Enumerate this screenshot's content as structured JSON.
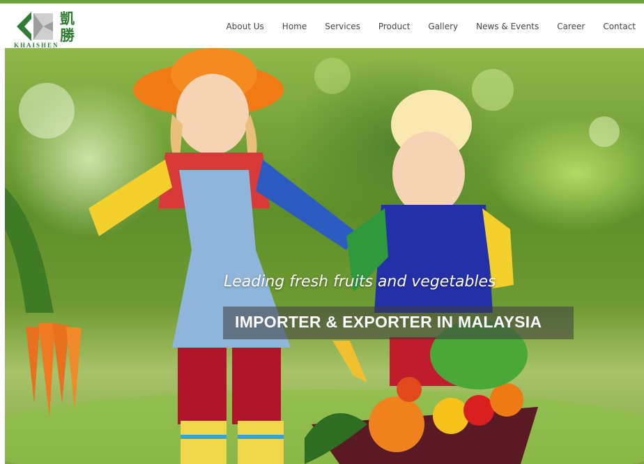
{
  "logo": {
    "chinese": "凱勝",
    "english": "KHAISHEN",
    "icon": "khaishen-logo-icon"
  },
  "nav": {
    "items": [
      {
        "label": "About Us"
      },
      {
        "label": "Home"
      },
      {
        "label": "Services"
      },
      {
        "label": "Product"
      },
      {
        "label": "Gallery"
      },
      {
        "label": "News & Events"
      },
      {
        "label": "Career"
      },
      {
        "label": "Contact"
      }
    ]
  },
  "hero": {
    "tagline": "Leading fresh fruits and vegetables",
    "banner": "IMPORTER & EXPORTER IN MALAYSIA"
  },
  "colors": {
    "brand_green": "#2e7d32",
    "topbar_green": "#6aa536",
    "nav_text": "#444444"
  }
}
